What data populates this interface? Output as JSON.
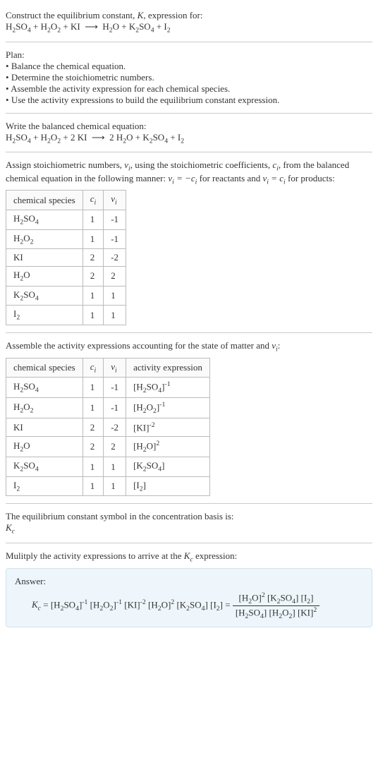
{
  "header": {
    "title_line1": "Construct the equilibrium constant, ",
    "title_k": "K",
    "title_line1b": ", expression for:",
    "equation_unbalanced": "H₂SO₄ + H₂O₂ + KI ⟶ H₂O + K₂SO₄ + I₂"
  },
  "plan": {
    "heading": "Plan:",
    "items": [
      "Balance the chemical equation.",
      "Determine the stoichiometric numbers.",
      "Assemble the activity expression for each chemical species.",
      "Use the activity expressions to build the equilibrium constant expression."
    ]
  },
  "balanced": {
    "heading": "Write the balanced chemical equation:",
    "equation": "H₂SO₄ + H₂O₂ + 2 KI ⟶ 2 H₂O + K₂SO₄ + I₂"
  },
  "stoich": {
    "intro1": "Assign stoichiometric numbers, ",
    "nu": "νᵢ",
    "intro2": ", using the stoichiometric coefficients, ",
    "ci": "cᵢ",
    "intro3": ", from the balanced chemical equation in the following manner: ",
    "rel1": "νᵢ = −cᵢ",
    "intro4": " for reactants and ",
    "rel2": "νᵢ = cᵢ",
    "intro5": " for products:",
    "headers": {
      "species": "chemical species",
      "ci": "cᵢ",
      "nu": "νᵢ"
    },
    "rows": [
      {
        "species": "H₂SO₄",
        "ci": "1",
        "nu": "-1"
      },
      {
        "species": "H₂O₂",
        "ci": "1",
        "nu": "-1"
      },
      {
        "species": "KI",
        "ci": "2",
        "nu": "-2"
      },
      {
        "species": "H₂O",
        "ci": "2",
        "nu": "2"
      },
      {
        "species": "K₂SO₄",
        "ci": "1",
        "nu": "1"
      },
      {
        "species": "I₂",
        "ci": "1",
        "nu": "1"
      }
    ]
  },
  "activity": {
    "intro": "Assemble the activity expressions accounting for the state of matter and νᵢ:",
    "headers": {
      "species": "chemical species",
      "ci": "cᵢ",
      "nu": "νᵢ",
      "expr": "activity expression"
    },
    "rows": [
      {
        "species": "H₂SO₄",
        "ci": "1",
        "nu": "-1",
        "base": "[H₂SO₄]",
        "exp": "-1"
      },
      {
        "species": "H₂O₂",
        "ci": "1",
        "nu": "-1",
        "base": "[H₂O₂]",
        "exp": "-1"
      },
      {
        "species": "KI",
        "ci": "2",
        "nu": "-2",
        "base": "[KI]",
        "exp": "-2"
      },
      {
        "species": "H₂O",
        "ci": "2",
        "nu": "2",
        "base": "[H₂O]",
        "exp": "2"
      },
      {
        "species": "K₂SO₄",
        "ci": "1",
        "nu": "1",
        "base": "[K₂SO₄]",
        "exp": ""
      },
      {
        "species": "I₂",
        "ci": "1",
        "nu": "1",
        "base": "[I₂]",
        "exp": ""
      }
    ]
  },
  "symbol": {
    "line": "The equilibrium constant symbol in the concentration basis is:",
    "kc": "K_c"
  },
  "final": {
    "heading": "Mulitply the activity expressions to arrive at the ",
    "kc": "K_c",
    "heading2": " expression:",
    "answer_label": "Answer:",
    "lhs": "K_c",
    "flat": "= [H₂SO₄]⁻¹ [H₂O₂]⁻¹ [KI]⁻² [H₂O]² [K₂SO₄] [I₂] =",
    "num": "[H₂O]² [K₂SO₄] [I₂]",
    "den": "[H₂SO₄] [H₂O₂] [KI]²"
  }
}
